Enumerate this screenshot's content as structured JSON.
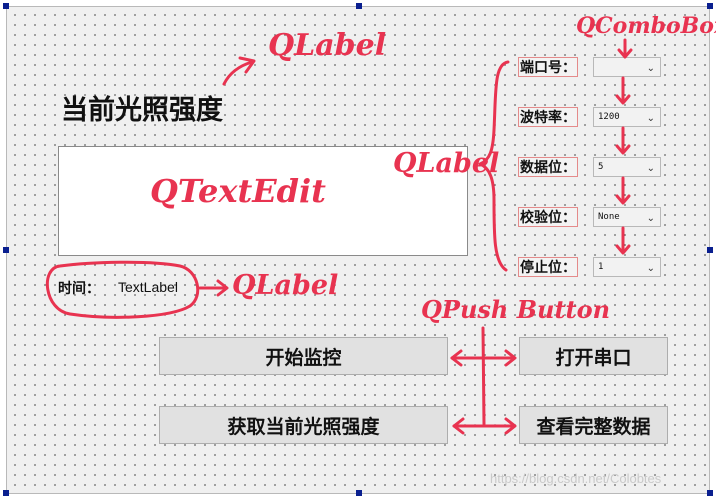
{
  "form": {
    "title": "当前光照强度",
    "time_label": "时间：",
    "time_value": "TextLabel"
  },
  "serial": {
    "port_label": "端口号：",
    "port_value": "",
    "baud_label": "波特率：",
    "baud_value": "1200",
    "databits_label": "数据位：",
    "databits_value": "5",
    "parity_label": "校验位：",
    "parity_value": "None",
    "stopbits_label": "停止位：",
    "stopbits_value": "1"
  },
  "buttons": {
    "start_monitor": "开始监控",
    "open_port": "打开串口",
    "get_light": "获取当前光照强度",
    "view_data": "查看完整数据"
  },
  "annotations": {
    "qlabel_title": "QLabel",
    "qtextedit": "QTextEdit",
    "qlabel_serial": "QLabel",
    "qcombobox": "QComboBox",
    "qlabel_time": "QLabel",
    "qpushbutton": "QPush Button"
  },
  "watermark": "https://blog.csdn.net/Colobtes",
  "colors": {
    "annotation": "#e83350",
    "selection_handle": "#0a1f8f"
  }
}
